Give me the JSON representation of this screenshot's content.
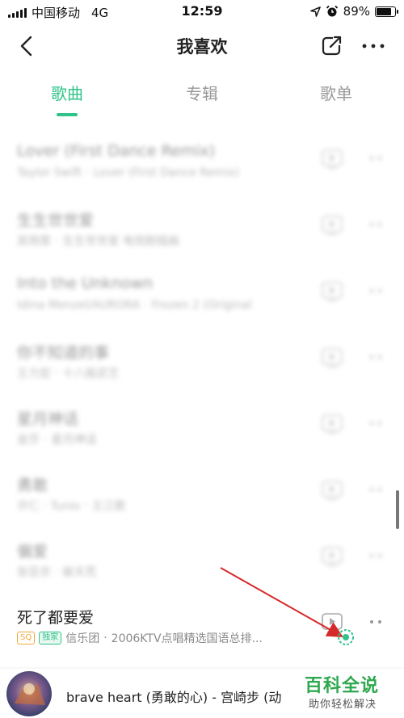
{
  "status_bar": {
    "carrier": "中国移动",
    "network": "4G",
    "time": "12:59",
    "battery": "89%",
    "battery_level": 0.89
  },
  "nav": {
    "title": "我喜欢"
  },
  "tabs": [
    {
      "label": "歌曲",
      "active": true
    },
    {
      "label": "专辑",
      "active": false
    },
    {
      "label": "歌单",
      "active": false
    }
  ],
  "songs": [
    {
      "title": "Lover (First Dance Remix)",
      "artist": "Taylor Swift",
      "album": "Lover (First Dance Remix)",
      "blurred": true
    },
    {
      "title": "生生世世爱",
      "artist": "吴雨霏",
      "album": "生生世世爱 电视剧插曲",
      "blurred": true
    },
    {
      "title": "Into the Unknown",
      "artist": "Idina Menzel/AURORA",
      "album": "Frozen 2 (Original",
      "blurred": true
    },
    {
      "title": "你不知道的事",
      "artist": "王力宏",
      "album": "十八般武艺",
      "blurred": true
    },
    {
      "title": "星月神话",
      "artist": "金莎",
      "album": "星月神话",
      "blurred": true
    },
    {
      "title": "勇敢",
      "artist": "许仁 · Tunio",
      "album": "王江歌",
      "blurred": true
    },
    {
      "title": "偏爱",
      "artist": "张芸京",
      "album": "破天荒",
      "blurred": true
    },
    {
      "title": "死了都要爱",
      "sq": "SQ",
      "exclusive": "独家",
      "artist": "信乐团",
      "album": "2006KTV点唱精选国语总排...",
      "blurred": false
    }
  ],
  "player": {
    "track": "brave heart (勇敢的心) - 宫崎步 (动"
  },
  "watermark": {
    "title": "百科全说",
    "subtitle": "助你轻松解决"
  },
  "colors": {
    "accent": "#2fc38a",
    "annotation_arrow": "#d62a2a"
  }
}
